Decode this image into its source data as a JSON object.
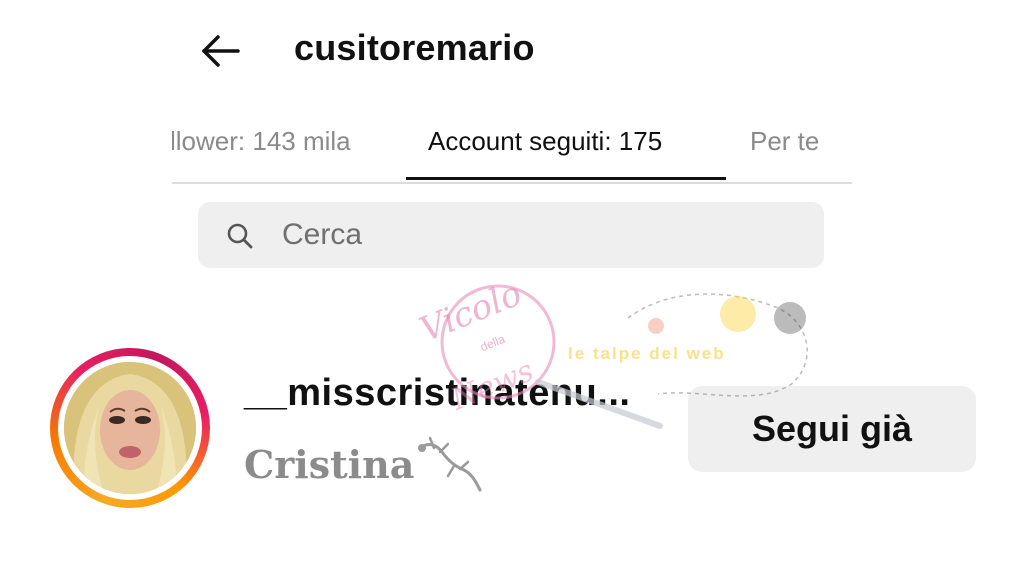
{
  "header": {
    "back_icon": "arrow-left-icon",
    "title": "cusitoremario"
  },
  "tabs": [
    {
      "label": "llower: 143 mila",
      "active": false
    },
    {
      "label": "Account seguiti: 175",
      "active": true
    },
    {
      "label": "Per te",
      "active": false
    }
  ],
  "search": {
    "icon": "search-icon",
    "placeholder": "Cerca"
  },
  "profile": {
    "username": "__misscristinatenu...",
    "display_name": "Cristina",
    "name_icon": "lizard-icon",
    "follow_label": "Segui già",
    "story_ring_colors": [
      "#f9a825",
      "#f57c00",
      "#e91e63",
      "#c2185b"
    ]
  },
  "watermark": {
    "text_top": "Vicolo",
    "text_small": "della",
    "text_bottom": "News",
    "text_side": "le talpe del web"
  }
}
